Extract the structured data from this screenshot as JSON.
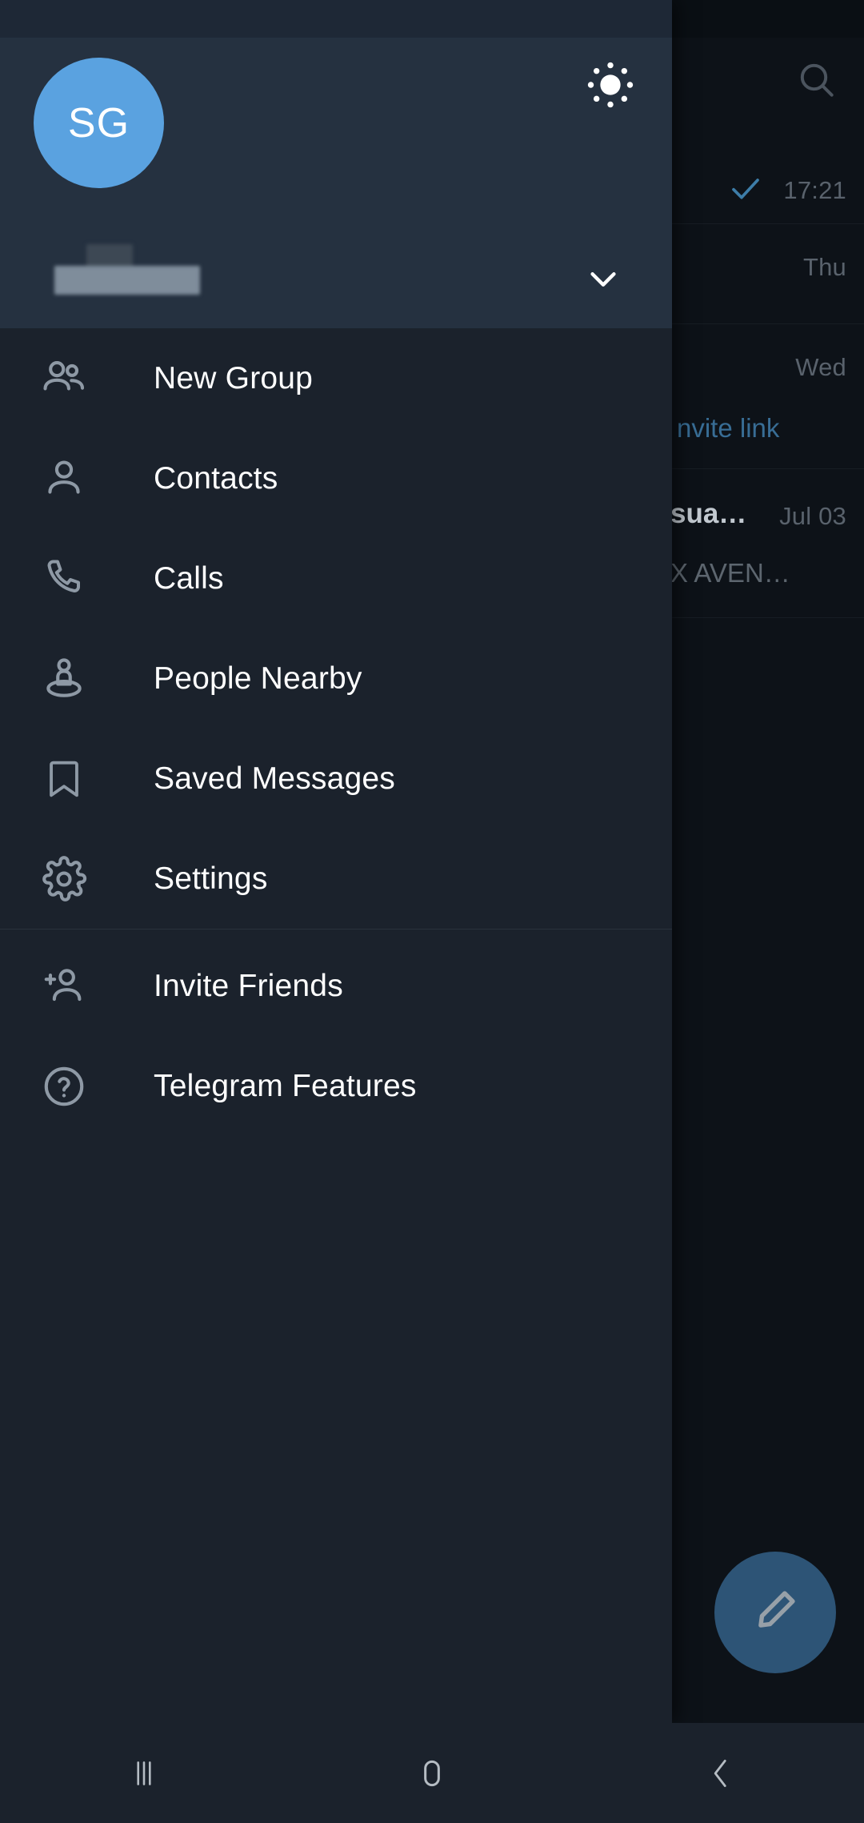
{
  "app": {
    "name": "Telegram"
  },
  "colors": {
    "drawer_header_bg": "#253140",
    "drawer_bg": "#1b222c",
    "chatlist_bg": "#0d1218",
    "avatar_bg": "#5aa2e0",
    "accent_blue": "#386d95",
    "fab_bg": "#2d5476",
    "icon_grey": "#8e99a5",
    "label_white": "#ffffff"
  },
  "drawer": {
    "avatar": {
      "initials": "SG",
      "name": "avatar"
    },
    "theme_toggle": {
      "icon": "sun-icon",
      "label": "Toggle day/night theme"
    },
    "account": {
      "name_redacted": true,
      "name_text": "",
      "expand_icon": "chevron-down-icon"
    },
    "sections": [
      {
        "items": [
          {
            "icon": "people-icon",
            "label": "New Group"
          },
          {
            "icon": "person-icon",
            "label": "Contacts"
          },
          {
            "icon": "phone-icon",
            "label": "Calls"
          },
          {
            "icon": "people-nearby-icon",
            "label": "People Nearby"
          },
          {
            "icon": "bookmark-icon",
            "label": "Saved Messages"
          },
          {
            "icon": "gear-icon",
            "label": "Settings"
          }
        ]
      },
      {
        "items": [
          {
            "icon": "person-add-icon",
            "label": "Invite Friends"
          },
          {
            "icon": "question-circle-icon",
            "label": "Telegram Features"
          }
        ]
      }
    ]
  },
  "chatlist": {
    "search": {
      "icon": "search-icon",
      "label": "Search"
    },
    "rows": [
      {
        "time": "17:21",
        "status_icon": "check-icon",
        "title": "",
        "preview": ""
      },
      {
        "time": "Thu",
        "status_icon": "",
        "title": "",
        "preview": ""
      },
      {
        "time": "Wed",
        "status_icon": "",
        "title": "",
        "preview": "",
        "link_text": "nvite link"
      },
      {
        "time": "Jul 03",
        "status_icon": "",
        "title": "sua…",
        "preview": "X AVEN…"
      }
    ],
    "fab": {
      "icon": "pencil-icon",
      "label": "New message"
    }
  },
  "navbar": {
    "buttons": [
      {
        "icon": "recents-icon",
        "label": "Recent apps"
      },
      {
        "icon": "home-icon",
        "label": "Home"
      },
      {
        "icon": "back-icon",
        "label": "Back"
      }
    ]
  }
}
